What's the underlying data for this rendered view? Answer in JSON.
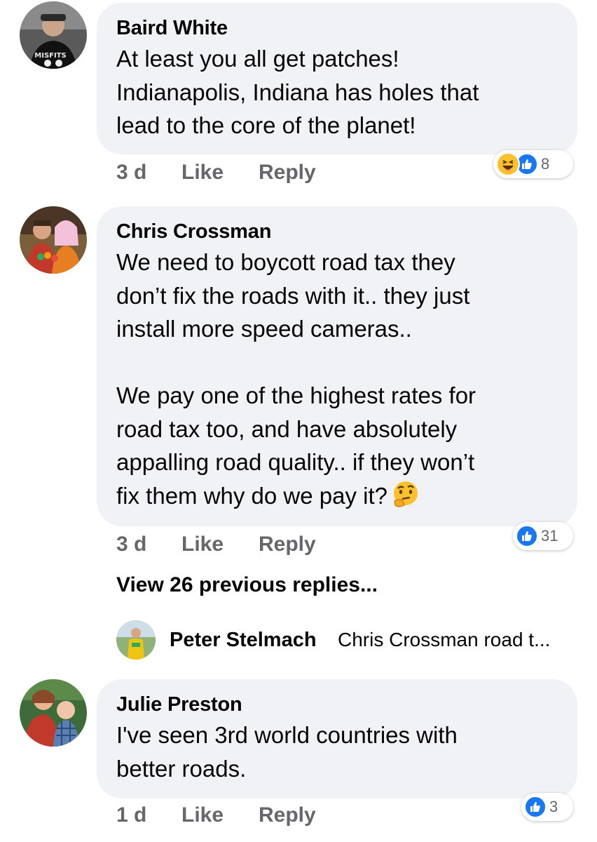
{
  "comments": [
    {
      "author": "Baird White",
      "text": "At least you all get patches!\nIndianapolis, Indiana has holes that\nlead to the core of the planet!",
      "time": "3 d",
      "like": "Like",
      "reply": "Reply",
      "reactions": [
        "haha-icon",
        "like-icon"
      ],
      "reaction_count": "8",
      "avatar_text": "MISFITS"
    },
    {
      "author": "Chris Crossman",
      "text": "We need to boycott road tax they\ndon’t fix the roads with it.. they just\ninstall more speed cameras..\n\nWe pay one of the highest rates for\nroad tax too, and have absolutely\nappalling road quality.. if they won’t\nfix them why do we pay it?",
      "emoji": "thinking-face-icon",
      "time": "3 d",
      "like": "Like",
      "reply": "Reply",
      "reactions": [
        "like-icon"
      ],
      "reaction_count": "31"
    },
    {
      "author": "Julie Preston",
      "text": "I've seen 3rd world countries with\nbetter roads.",
      "time": "1 d",
      "like": "Like",
      "reply": "Reply",
      "reactions": [
        "like-icon"
      ],
      "reaction_count": "3"
    }
  ],
  "view_previous": "View 26 previous replies...",
  "latest_reply": {
    "author": "Peter Stelmach",
    "preview": "Chris Crossman road t..."
  },
  "colors": {
    "bubble": "#f0f2f5",
    "meta": "#65676b",
    "like_blue": "#1877f2"
  }
}
